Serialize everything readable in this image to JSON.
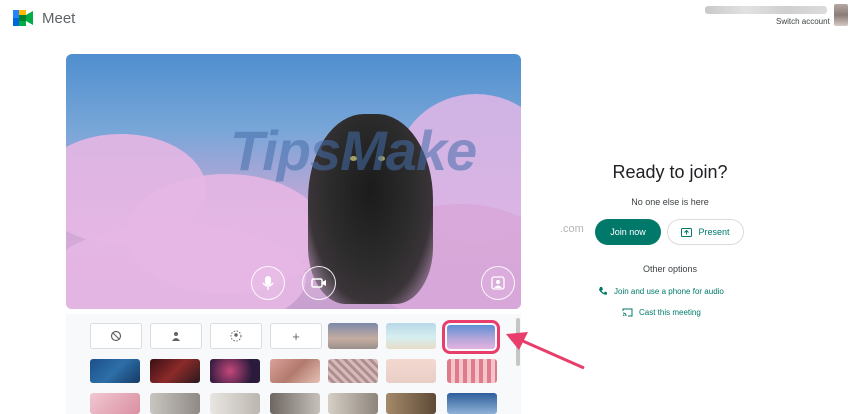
{
  "header": {
    "app_name": "Meet",
    "switch_account": "Switch account"
  },
  "preview": {
    "controls": [
      "more-options",
      "microphone",
      "camera",
      "apply-visual-effects"
    ]
  },
  "backgrounds": {
    "effect_tiles": [
      "no-effect",
      "slight-blur",
      "blur",
      "upload-background"
    ],
    "selected_index": 6
  },
  "join_panel": {
    "title": "Ready to join?",
    "subtitle": "No one else is here",
    "join_label": "Join now",
    "present_label": "Present",
    "other_options": "Other options",
    "phone_option": "Join and use a phone for audio",
    "cast_option": "Cast this meeting"
  },
  "colors": {
    "accent": "#00796b",
    "highlight": "#e83e6b"
  }
}
